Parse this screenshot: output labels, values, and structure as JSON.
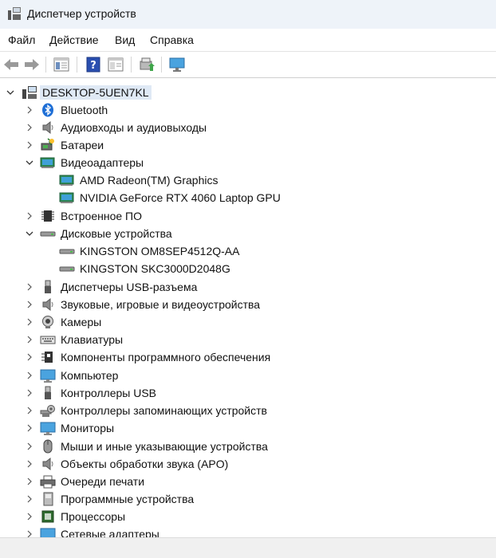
{
  "window": {
    "title": "Диспетчер устройств"
  },
  "menu": [
    "Файл",
    "Действие",
    "Вид",
    "Справка"
  ],
  "toolbar": {
    "buttons": [
      "back-arrow-icon",
      "forward-arrow-icon",
      "properties-icon",
      "help-icon",
      "show-hide-icon",
      "update-driver-icon",
      "monitor-icon"
    ]
  },
  "tree": {
    "root": "DESKTOP-5UEN7KL",
    "categories": [
      {
        "label": "Bluetooth",
        "icon": "bluetooth-icon",
        "expanded": false
      },
      {
        "label": "Аудиовходы и аудиовыходы",
        "icon": "speaker-icon",
        "expanded": false
      },
      {
        "label": "Батареи",
        "icon": "battery-icon",
        "expanded": false
      },
      {
        "label": "Видеоадаптеры",
        "icon": "display-adapter-icon",
        "expanded": true,
        "children": [
          "AMD Radeon(TM) Graphics",
          "NVIDIA GeForce RTX 4060 Laptop GPU"
        ]
      },
      {
        "label": "Встроенное ПО",
        "icon": "firmware-icon",
        "expanded": false
      },
      {
        "label": "Дисковые устройства",
        "icon": "disk-drive-icon",
        "expanded": true,
        "children": [
          "KINGSTON OM8SEP4512Q-AA",
          "KINGSTON SKC3000D2048G"
        ]
      },
      {
        "label": "Диспетчеры USB-разъема",
        "icon": "usb-connector-icon",
        "expanded": false
      },
      {
        "label": "Звуковые, игровые и видеоустройства",
        "icon": "sound-icon",
        "expanded": false
      },
      {
        "label": "Камеры",
        "icon": "camera-icon",
        "expanded": false
      },
      {
        "label": "Клавиатуры",
        "icon": "keyboard-icon",
        "expanded": false
      },
      {
        "label": "Компоненты программного обеспечения",
        "icon": "software-component-icon",
        "expanded": false
      },
      {
        "label": "Компьютер",
        "icon": "computer-icon",
        "expanded": false
      },
      {
        "label": "Контроллеры USB",
        "icon": "usb-controller-icon",
        "expanded": false
      },
      {
        "label": "Контроллеры запоминающих устройств",
        "icon": "storage-controller-icon",
        "expanded": false
      },
      {
        "label": "Мониторы",
        "icon": "monitor-icon",
        "expanded": false
      },
      {
        "label": "Мыши и иные указывающие устройства",
        "icon": "mouse-icon",
        "expanded": false
      },
      {
        "label": "Объекты обработки звука (APO)",
        "icon": "audio-processing-icon",
        "expanded": false
      },
      {
        "label": "Очереди печати",
        "icon": "printer-icon",
        "expanded": false
      },
      {
        "label": "Программные устройства",
        "icon": "software-device-icon",
        "expanded": false
      },
      {
        "label": "Процессоры",
        "icon": "processor-icon",
        "expanded": false
      },
      {
        "label": "Сетевые адаптеры",
        "icon": "network-adapter-icon",
        "expanded": false
      }
    ]
  }
}
